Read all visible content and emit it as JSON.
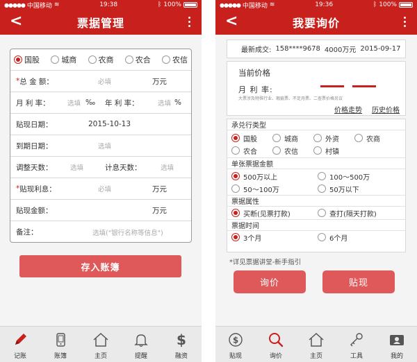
{
  "left": {
    "status": {
      "carrier": "中国移动",
      "time": "19:38",
      "battery": "100%"
    },
    "nav": {
      "title": "票据管理",
      "back": "<"
    },
    "bank_types": [
      {
        "label": "国股",
        "selected": true
      },
      {
        "label": "城商",
        "selected": false
      },
      {
        "label": "农商",
        "selected": false
      },
      {
        "label": "农合",
        "selected": false
      },
      {
        "label": "农信",
        "selected": false
      }
    ],
    "form": {
      "total_label_req": "*",
      "total_label": "总 金 额：",
      "required_ph": "必填",
      "unit_wan": "万元",
      "monthly_label": "月 利 率：",
      "optional_ph": "选填",
      "permille": "‰",
      "annual_label": "年 利 率：",
      "percent": "%",
      "discount_date_label": "贴现日期：",
      "discount_date_value": "2015-10-13",
      "due_date_label": "到期日期：",
      "adjust_days_label": "调整天数：",
      "interest_days_label": "计息天数：",
      "interest_label_req": "*",
      "interest_label": "贴现利息：",
      "amount_label": "贴现金额：",
      "remark_label": "备注：",
      "remark_ph": "选填(\"银行名称等信息\")"
    },
    "save_label": "存入账簿",
    "tabs": [
      {
        "label": "记账",
        "icon": "pencil-icon"
      },
      {
        "label": "账簿",
        "icon": "phone-book-icon"
      },
      {
        "label": "主页",
        "icon": "home-icon"
      },
      {
        "label": "提醒",
        "icon": "bell-icon"
      },
      {
        "label": "融资",
        "icon": "dollar-icon"
      }
    ]
  },
  "right": {
    "status": {
      "carrier": "中国移动",
      "time": "19:36",
      "battery": "100%"
    },
    "nav": {
      "title": "我要询价",
      "back": "<"
    },
    "latest": {
      "label": "最新成交:",
      "phone": "158****9678",
      "amount": "4000万元",
      "date": "2015-09-17"
    },
    "price": {
      "title": "当前价格",
      "rate_label": "月 利 率:",
      "note": "大票涉及特殊行业、瑕疵票、不足月票、二查票价格另议",
      "trend_link": "价格走势",
      "history_link": "历史价格"
    },
    "sections": {
      "bank_title": "承兑行类型",
      "bank_options": [
        {
          "label": "国股",
          "selected": true
        },
        {
          "label": "城商",
          "selected": false
        },
        {
          "label": "外资",
          "selected": false
        },
        {
          "label": "农商",
          "selected": false
        },
        {
          "label": "农合",
          "selected": false
        },
        {
          "label": "农信",
          "selected": false
        },
        {
          "label": "村镇",
          "selected": false
        }
      ],
      "amount_title": "单张票据金额",
      "amount_options": [
        {
          "label": "500万以上",
          "selected": true
        },
        {
          "label": "100～500万",
          "selected": false
        },
        {
          "label": "50～100万",
          "selected": false
        },
        {
          "label": "50万以下",
          "selected": false
        }
      ],
      "attr_title": "票据属性",
      "attr_options": [
        {
          "label": "买断(见票打款)",
          "selected": true
        },
        {
          "label": "查打(隔天打款)",
          "selected": false
        }
      ],
      "time_title": "票据时间",
      "time_options": [
        {
          "label": "3个月",
          "selected": true
        },
        {
          "label": "6个月",
          "selected": false
        }
      ]
    },
    "hint": "*详见票据讲堂-新手指引",
    "inquiry_label": "询价",
    "discount_label": "贴现",
    "tabs": [
      {
        "label": "贴现",
        "icon": "dollar-circle-icon"
      },
      {
        "label": "询价",
        "icon": "search-icon"
      },
      {
        "label": "主页",
        "icon": "home-icon"
      },
      {
        "label": "工具",
        "icon": "key-icon"
      },
      {
        "label": "我的",
        "icon": "id-card-icon"
      }
    ]
  },
  "colors": {
    "brand_red": "#c8201d",
    "button_red": "#e0595a"
  }
}
